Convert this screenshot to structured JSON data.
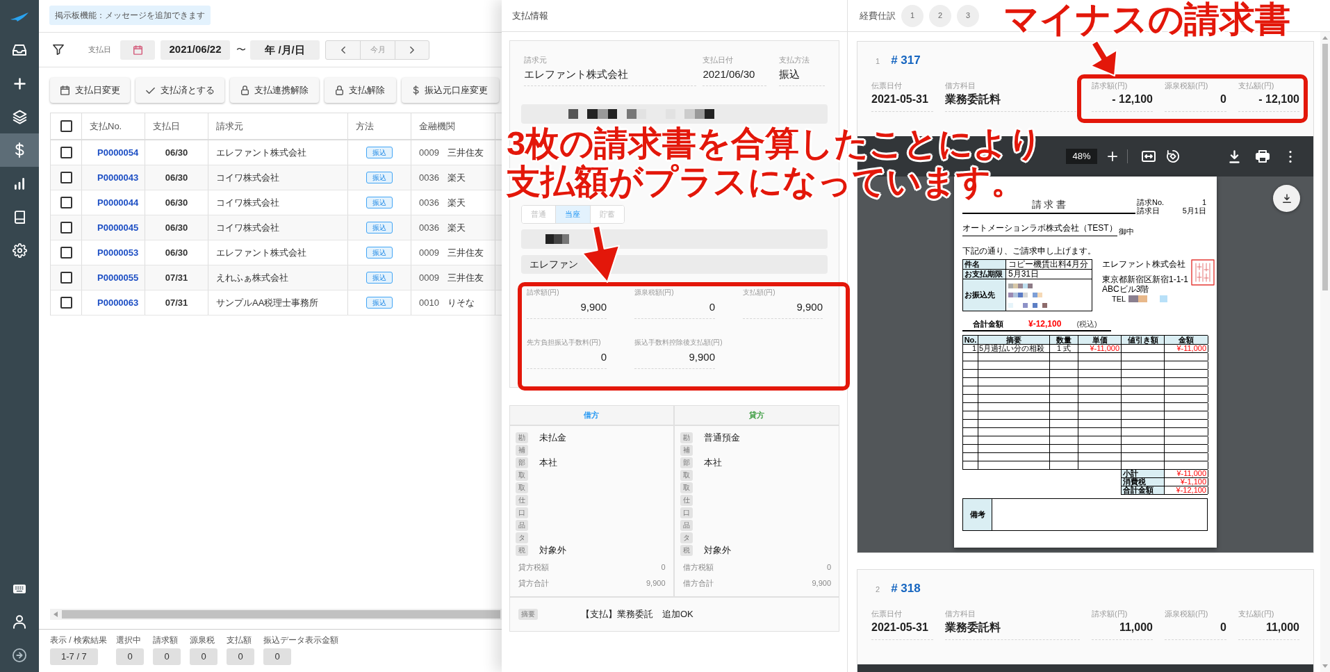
{
  "sidebar": {
    "items": [
      {
        "selected": false
      },
      {
        "selected": false
      },
      {
        "selected": false
      },
      {
        "selected": true
      },
      {
        "selected": false
      },
      {
        "selected": false
      },
      {
        "selected": false
      }
    ]
  },
  "notice": {
    "text": "掲示板機能：メッセージを追加できます"
  },
  "filter": {
    "label": "支払日",
    "date_from": "2021/06/22",
    "separator": "〜",
    "date_to": {
      "placeholder": "年 /月/日"
    },
    "period": {
      "current": "今月"
    }
  },
  "actions": [
    {
      "kind": "calendar",
      "label": "支払日変更"
    },
    {
      "kind": "check",
      "label": "支払済とする"
    },
    {
      "kind": "lock",
      "label": "支払連携解除"
    },
    {
      "kind": "lock",
      "label": "支払解除"
    },
    {
      "kind": "dollar",
      "label": "振込元口座変更"
    }
  ],
  "table": {
    "all_checked": false,
    "columns": [
      "支払No.",
      "支払日",
      "請求元",
      "方法",
      "金融機関"
    ],
    "rows": [
      {
        "checked": false,
        "no": "P0000054",
        "date": "06/30",
        "payee": "エレファント株式会社",
        "method": "振込",
        "bank_code": "0009",
        "bank": "三井住友"
      },
      {
        "checked": false,
        "no": "P0000043",
        "date": "06/30",
        "payee": "コイワ株式会社",
        "method": "振込",
        "bank_code": "0036",
        "bank": "楽天"
      },
      {
        "checked": false,
        "no": "P0000044",
        "date": "06/30",
        "payee": "コイワ株式会社",
        "method": "振込",
        "bank_code": "0036",
        "bank": "楽天"
      },
      {
        "checked": false,
        "no": "P0000045",
        "date": "06/30",
        "payee": "コイワ株式会社",
        "method": "振込",
        "bank_code": "0036",
        "bank": "楽天"
      },
      {
        "checked": false,
        "no": "P0000053",
        "date": "06/30",
        "payee": "エレファント株式会社",
        "method": "振込",
        "bank_code": "0009",
        "bank": "三井住友"
      },
      {
        "checked": false,
        "no": "P0000055",
        "date": "07/31",
        "payee": "えれふぁ株式会社",
        "method": "振込",
        "bank_code": "0009",
        "bank": "三井住友"
      },
      {
        "checked": false,
        "no": "P0000063",
        "date": "07/31",
        "payee": "サンプルAA税理士事務所",
        "method": "振込",
        "bank_code": "0010",
        "bank": "りそな"
      }
    ]
  },
  "summary": [
    {
      "label": "表示 / 検索結果",
      "value": "1-7 / 7"
    },
    {
      "label": "選択中",
      "value": "0"
    },
    {
      "label": "請求額",
      "value": "0"
    },
    {
      "label": "源泉税",
      "value": "0"
    },
    {
      "label": "支払額",
      "value": "0"
    },
    {
      "label": "振込データ表示金額",
      "value": "0"
    }
  ],
  "payment": {
    "title": "支払情報",
    "header_fields": [
      {
        "label": "請求元",
        "value": "エレファント株式会社"
      },
      {
        "label": "支払日付",
        "value": "2021/06/30"
      },
      {
        "label": "支払方法",
        "value": "振込"
      }
    ],
    "account_types": [
      {
        "label": "普通",
        "selected": false
      },
      {
        "label": "当座",
        "selected": true
      },
      {
        "label": "貯蓄",
        "selected": false
      }
    ],
    "account_holder": "エレファン",
    "amounts": [
      {
        "label": "請求額(円)",
        "value": "9,900"
      },
      {
        "label": "源泉税額(円)",
        "value": "0"
      },
      {
        "label": "支払額(円)",
        "value": "9,900"
      },
      {
        "label": "先方負担振込手数料(円)",
        "value": "0"
      },
      {
        "label": "振込手数料控除後支払額(円)",
        "value": "9,900"
      }
    ],
    "journal": {
      "sides": [
        {
          "heading": "借方",
          "rows": [
            {
              "tag": "勘",
              "value": "未払金"
            },
            {
              "tag": "補"
            },
            {
              "tag": "部",
              "value": "本社"
            },
            {
              "tag": "取"
            },
            {
              "tag": "取"
            },
            {
              "tag": "仕"
            },
            {
              "tag": "口"
            },
            {
              "tag": "品"
            },
            {
              "tag": "タ"
            },
            {
              "tag": "税",
              "value": "対象外"
            }
          ],
          "totals": [
            {
              "label": "貸方税額",
              "value": "0"
            },
            {
              "label": "貸方合計",
              "value": "9,900"
            }
          ]
        },
        {
          "heading": "貸方",
          "rows": [
            {
              "tag": "勘",
              "value": "普通預金"
            },
            {
              "tag": "補"
            },
            {
              "tag": "部",
              "value": "本社"
            },
            {
              "tag": "取"
            },
            {
              "tag": "取"
            },
            {
              "tag": "仕"
            },
            {
              "tag": "口"
            },
            {
              "tag": "品"
            },
            {
              "tag": "タ"
            },
            {
              "tag": "税",
              "value": "対象外"
            }
          ],
          "totals": [
            {
              "label": "借方税額",
              "value": "0"
            },
            {
              "label": "借方合計",
              "value": "9,900"
            }
          ]
        }
      ],
      "note": {
        "tag": "摘要",
        "text": "【支払】業務委託　追加OK"
      }
    }
  },
  "entries": {
    "title": "経費仕訳",
    "pages": [
      "1",
      "2",
      "3"
    ],
    "items": [
      {
        "index": "1",
        "number": "# 317",
        "fields": [
          {
            "label": "伝票日付",
            "value": "2021-05-31"
          },
          {
            "label": "借方科目",
            "value": "業務委託料"
          },
          {
            "label": "請求額(円)",
            "value": "- 12,100"
          },
          {
            "label": "源泉税額(円)",
            "value": "0"
          },
          {
            "label": "支払額(円)",
            "value": "- 12,100"
          }
        ],
        "viewer": {
          "zoom": "48%",
          "document": {
            "title": "請 求 書",
            "meta": [
              {
                "label": "請求No.",
                "value": "1"
              },
              {
                "label": "請求日",
                "value": "5月1日"
              }
            ],
            "recipient": "オートメーションラボ株式会社（TEST）",
            "honorific": "御中",
            "intro": "下記の通り、ご請求申し上げます。",
            "details": [
              {
                "label": "件名",
                "value": "コピー機賃出料4月分"
              },
              {
                "label": "お支払期限",
                "value": "5月31日"
              },
              {
                "label": "お振込先",
                "redacted": true
              }
            ],
            "issuer": [
              "エレファント株式会社",
              "東京都新宿区新宿1-1-1",
              "ABCビル3階"
            ],
            "tel": {
              "label": "TEL",
              "redacted": true
            },
            "total": {
              "label": "合計金額",
              "value": "¥-12,100",
              "note": "(税込)"
            },
            "columns": [
              "No.",
              "摘要",
              "数量",
              "単価",
              "値引き額",
              "金額"
            ],
            "items": [
              {
                "no": "1",
                "description": "5月過払い分の相殺",
                "quantity": "1 式",
                "unit_price": "¥-11,000",
                "amount": "¥-11,000"
              }
            ],
            "summary": [
              {
                "label": "小計",
                "value": "¥-11,000"
              },
              {
                "label": "消費税",
                "value": "¥-1,100"
              },
              {
                "label": "合計金額",
                "value": "¥-12,100"
              }
            ],
            "remarks_label": "備考"
          }
        }
      },
      {
        "index": "2",
        "number": "# 318",
        "fields": [
          {
            "label": "伝票日付",
            "value": "2021-05-31"
          },
          {
            "label": "借方科目",
            "value": "業務委託料"
          },
          {
            "label": "請求額(円)",
            "value": "11,000"
          },
          {
            "label": "源泉税額(円)",
            "value": "0"
          },
          {
            "label": "支払額(円)",
            "value": "11,000"
          }
        ]
      }
    ]
  },
  "annotations": [
    {
      "lines": [
        "3枚の請求書を合算したことにより",
        "支払額がプラスになっています。"
      ]
    },
    {
      "lines": [
        "マイナスの請求書"
      ]
    }
  ]
}
